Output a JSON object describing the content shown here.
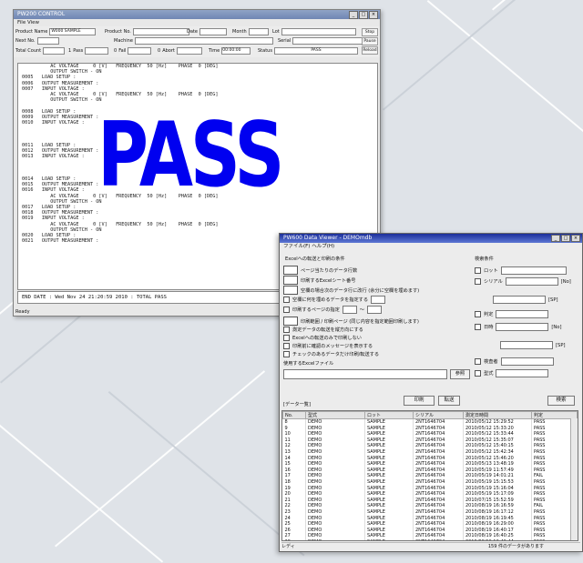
{
  "window1": {
    "title": "PW200 CONTROL",
    "menu": "File  View",
    "header": {
      "product_name_label": "Product Name",
      "product_name_value": "W000 SAMPLE",
      "product_no_label": "Product No.",
      "date_label": "Date",
      "month_label": "Month",
      "lot_label": "Lot",
      "next_no_label": "Next No.",
      "machine_label": "Machine",
      "serial_label": "Serial",
      "total_count_label": "Total Count",
      "pass_label": "Pass",
      "pass_value": "1",
      "fail_label": "Fail",
      "fail_value": "0",
      "abort_label": "Abort",
      "abort_value": "0",
      "time_label": "Time",
      "time_value": "00:00:00",
      "status_label": "Status",
      "status_value": "PASS"
    },
    "side_buttons": [
      "Stop",
      "Pause",
      "Reload"
    ],
    "log_text": "          AC VOLTAGE     0 [V]   FREQUENCY  50 [Hz]    PHASE  0 [DEG]\n          OUTPUT SWITCH - ON\n0005   LOAD SETUP :\n0006   OUTPUT MEASUREMENT :\n0007   INPUT VOLTAGE :\n          AC VOLTAGE     0 [V]   FREQUENCY  50 [Hz]    PHASE  0 [DEG]\n          OUTPUT SWITCH - ON\n\n0008   LOAD SETUP :\n0009   OUTPUT MEASUREMENT :\n0010   INPUT VOLTAGE :\n\n\n\n0011   LOAD SETUP :\n0012   OUTPUT MEASUREMENT :\n0013   INPUT VOLTAGE :\n\n\n\n0014   LOAD SETUP :\n0015   OUTPUT MEASUREMENT :\n0016   INPUT VOLTAGE :\n          AC VOLTAGE     0 [V]   FREQUENCY  50 [Hz]    PHASE  0 [DEG]\n          OUTPUT SWITCH - ON\n0017   LOAD SETUP :\n0018   OUTPUT MEASUREMENT :\n0019   INPUT VOLTAGE :\n          AC VOLTAGE     0 [V]   FREQUENCY  50 [Hz]    PHASE  0 [DEG]\n          OUTPUT SWITCH - ON\n0020   LOAD SETUP :\n0021   OUTPUT MEASUREMENT :",
    "big_result": "PASS",
    "end_line": "END DATE : Wed Nov 24 21:20:59 2010 : TOTAL PASS",
    "footer": "Ready"
  },
  "window2": {
    "title": "PW600 Data Viewer - DEMOmdb",
    "menu": "ファイル(F)  ヘルプ(H)",
    "options_header": "Excelへの転送と印刷の条件",
    "options": [
      "ページ当たりのデータ行数",
      "印刷するExcelシート番号",
      "空欄の場合次のデータ行に改行 (余分に空欄を埋めます)",
      "空欄に何を埋めるデータを指定する",
      "印刷するページの指定",
      "印刷範囲 / 印刷ページ (同じ内容を指定範囲印刷します)",
      "測定データの転送を縦方向にする",
      "Excelへの転送のみで印刷しない",
      "印刷前に確認のメッセージを表示する",
      "チェックのあるデータだけ印刷/転送する"
    ],
    "excel_file_label": "使用するExcelファイル",
    "browse_label": "参照",
    "search_header": "検索条件",
    "search_fields": [
      "ロット",
      "シリアル",
      "判定",
      "日時",
      "検査者",
      "型式"
    ],
    "unit_labels": [
      "[No]",
      "[SP]",
      "[No]",
      "[SP]"
    ],
    "print_button": "印刷",
    "transfer_button": "転送",
    "search_button": "検索",
    "list_label": "[データ一覧]",
    "columns": [
      "No.",
      "型式",
      "ロット",
      "シリアル",
      "測定日時間",
      "判定"
    ],
    "rows": [
      [
        "8",
        "DEMO",
        "SAMPLE",
        "2NT1646704",
        "2010/05/12 15:29:52",
        "PASS"
      ],
      [
        "9",
        "DEMO",
        "SAMPLE",
        "2NT1646704",
        "2010/05/12 15:33:20",
        "PASS"
      ],
      [
        "10",
        "DEMO",
        "SAMPLE",
        "2NT1646704",
        "2010/05/12 15:33:44",
        "PASS"
      ],
      [
        "11",
        "DEMO",
        "SAMPLE",
        "2NT1646704",
        "2010/05/12 15:35:07",
        "PASS"
      ],
      [
        "12",
        "DEMO",
        "SAMPLE",
        "2NT1646704",
        "2010/05/12 15:40:15",
        "PASS"
      ],
      [
        "13",
        "DEMO",
        "SAMPLE",
        "2NT1646704",
        "2010/05/12 15:42:34",
        "PASS"
      ],
      [
        "14",
        "DEMO",
        "SAMPLE",
        "2NT1646704",
        "2010/05/12 15:46:20",
        "PASS"
      ],
      [
        "15",
        "DEMO",
        "SAMPLE",
        "2NT1646704",
        "2010/05/13 13:48:19",
        "PASS"
      ],
      [
        "16",
        "DEMO",
        "SAMPLE",
        "2NT1646704",
        "2010/05/19 11:57:49",
        "PASS"
      ],
      [
        "17",
        "DEMO",
        "SAMPLE",
        "2NT1646704",
        "2010/05/19 14:01:21",
        "FAIL"
      ],
      [
        "18",
        "DEMO",
        "SAMPLE",
        "2NT1646704",
        "2010/05/19 15:15:53",
        "PASS"
      ],
      [
        "19",
        "DEMO",
        "SAMPLE",
        "2NT1646704",
        "2010/05/19 15:16:04",
        "PASS"
      ],
      [
        "20",
        "DEMO",
        "SAMPLE",
        "2NT1646704",
        "2010/05/19 15:17:09",
        "PASS"
      ],
      [
        "21",
        "DEMO",
        "SAMPLE",
        "2NT1646704",
        "2010/07/15 15:52:59",
        "PASS"
      ],
      [
        "22",
        "DEMO",
        "SAMPLE",
        "2NT1646704",
        "2010/08/19 16:16:59",
        "FAIL"
      ],
      [
        "23",
        "DEMO",
        "SAMPLE",
        "2NT1646704",
        "2010/08/19 16:17:12",
        "PASS"
      ],
      [
        "24",
        "DEMO",
        "SAMPLE",
        "2NT1646704",
        "2010/08/19 16:19:45",
        "PASS"
      ],
      [
        "25",
        "DEMO",
        "SAMPLE",
        "2NT1646704",
        "2010/08/19 16:29:00",
        "PASS"
      ],
      [
        "26",
        "DEMO",
        "SAMPLE",
        "2NT1646704",
        "2010/08/19 16:40:17",
        "PASS"
      ],
      [
        "27",
        "DEMO",
        "SAMPLE",
        "2NT1646704",
        "2010/08/19 16:40:25",
        "PASS"
      ],
      [
        "28",
        "DEMO",
        "SAMPLE",
        "2NT1646704",
        "2010/08/19 16:40:44",
        "PASS"
      ]
    ],
    "footer_left": "レディ",
    "footer_right": "159 件のデータがあります"
  }
}
